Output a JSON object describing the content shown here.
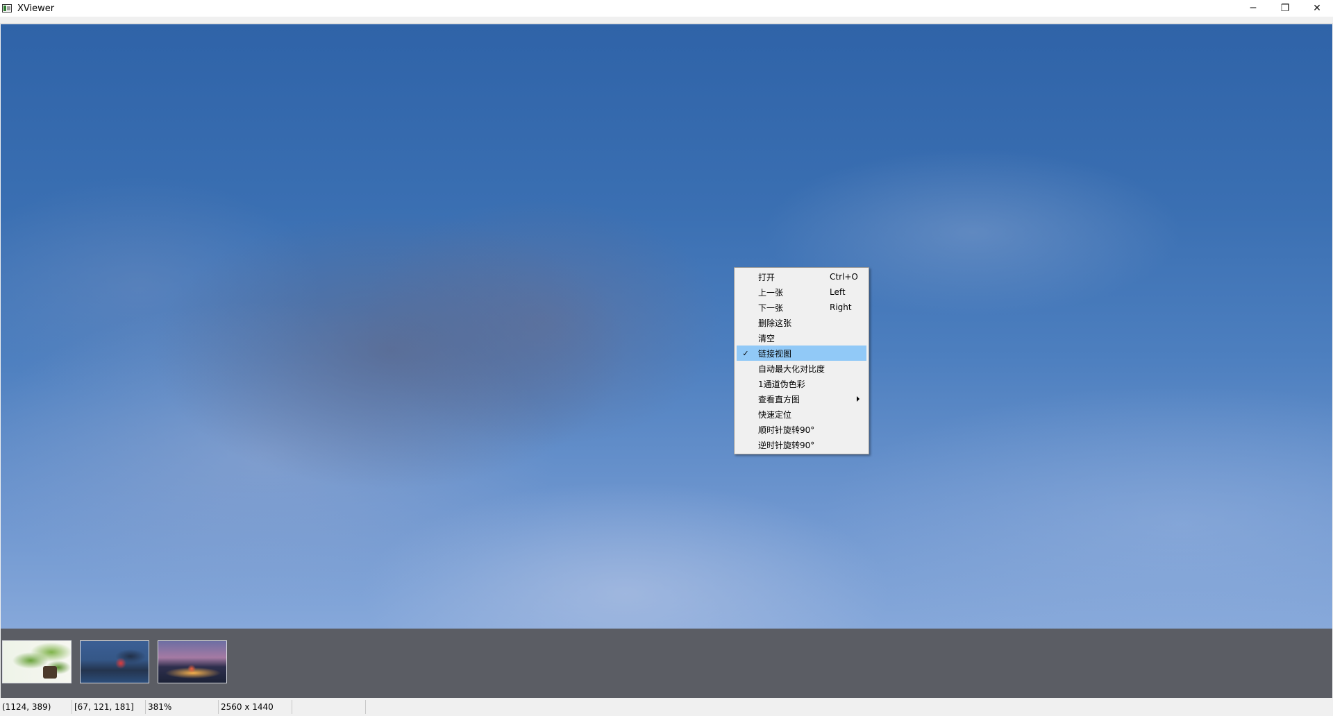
{
  "window": {
    "title": "XViewer",
    "controls": {
      "minimize": "─",
      "restore": "❐",
      "close": "✕"
    }
  },
  "thumbnails": [
    {
      "name": "bonsai"
    },
    {
      "name": "night-rock"
    },
    {
      "name": "harbor-sunset"
    }
  ],
  "statusbar": {
    "coords": "(1124, 389)",
    "pixel": "[67, 121, 181]",
    "zoom": "381%",
    "size": "2560 x 1440"
  },
  "context_menu": {
    "items": [
      {
        "label": "打开",
        "shortcut": "Ctrl+O"
      },
      {
        "label": "上一张",
        "shortcut": "Left"
      },
      {
        "label": "下一张",
        "shortcut": "Right"
      },
      {
        "label": "删除这张",
        "shortcut": ""
      },
      {
        "label": "清空",
        "shortcut": ""
      },
      {
        "label": "链接视图",
        "shortcut": "",
        "checked": true,
        "check_mark": "✓"
      },
      {
        "label": "自动最大化对比度",
        "shortcut": ""
      },
      {
        "label": "1通道伪色彩",
        "shortcut": ""
      },
      {
        "label": "查看直方图",
        "shortcut": "",
        "submenu": true
      },
      {
        "label": "快速定位",
        "shortcut": ""
      },
      {
        "label": "顺时针旋转90°",
        "shortcut": ""
      },
      {
        "label": "逆时针旋转90°",
        "shortcut": ""
      }
    ]
  },
  "colors": {
    "menu_highlight": "#91c9f7",
    "thumbstrip_bg": "#5b5d64",
    "sky_blue": "#3a6fb2"
  }
}
